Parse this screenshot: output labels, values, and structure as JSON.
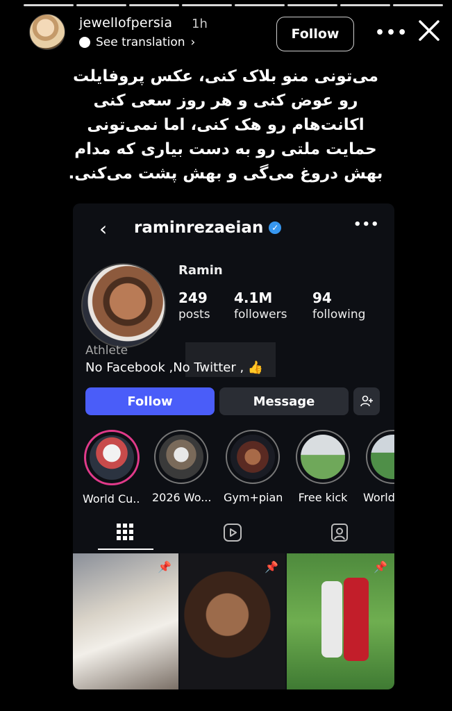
{
  "story": {
    "username": "jewellofpersia",
    "time": "1h",
    "translate_label": "See translation",
    "translate_chevron": "›",
    "follow_label": "Follow",
    "more_icon": "more-icon",
    "close_icon": "close-icon",
    "caption_lines": [
      "می‌تونی منو بلاک کنی، عکس پروفایلت",
      "رو عوض کنی و هر روز سعی کنی",
      "اکانت‌هام رو هک کنی، اما نمی‌تونی",
      "حمایت ملتی رو به دست بیاری که مدام",
      "بهش دروغ می‌گی و بهش پشت می‌کنی."
    ]
  },
  "profile": {
    "back_glyph": "‹",
    "handle": "raminrezaeian",
    "verified_glyph": "✓",
    "more_glyph": "•••",
    "name": "Ramin",
    "stats": [
      {
        "num": "249",
        "label": "posts"
      },
      {
        "num": "4.1M",
        "label": "followers"
      },
      {
        "num": "94",
        "label": "following"
      }
    ],
    "category": "Athlete",
    "bio": "No Facebook ,No Twitter , 👍",
    "follow_label": "Follow",
    "message_label": "Message",
    "highlights": [
      {
        "label": "World Cu..."
      },
      {
        "label": "2026 Wo..."
      },
      {
        "label": "Gym+piano"
      },
      {
        "label": "Free kick"
      },
      {
        "label": "World"
      }
    ],
    "accent": "#4a5df9"
  }
}
